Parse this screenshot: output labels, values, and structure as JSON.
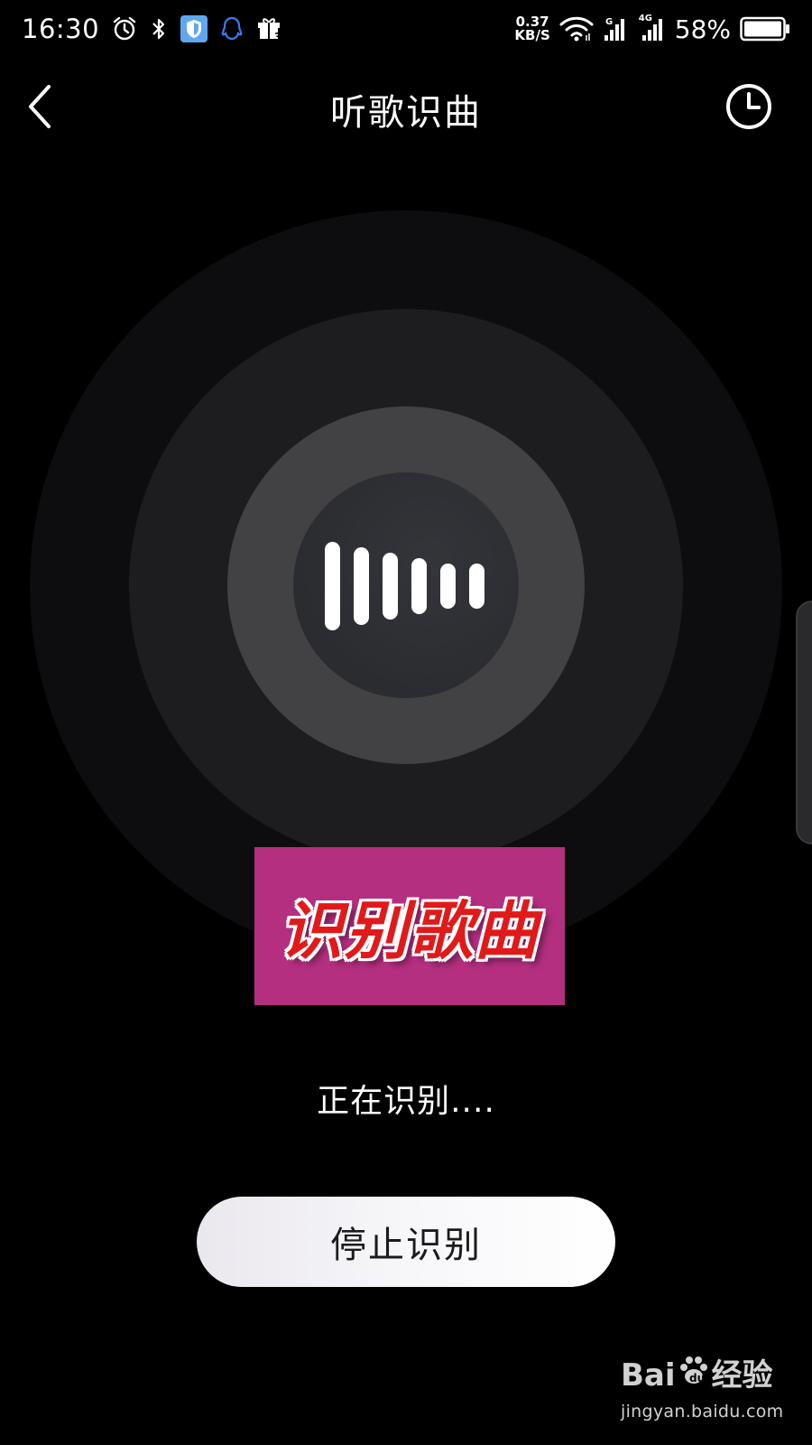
{
  "status_bar": {
    "time": "16:30",
    "net_speed_value": "0.37",
    "net_speed_unit": "KB/S",
    "network_type_label": "4G",
    "battery_percent": "58%",
    "left_icons": [
      "alarm-icon",
      "bluetooth-icon",
      "shield-app-icon",
      "qq-icon",
      "gift-icon"
    ],
    "right_icons": [
      "wifi-icon",
      "signal-icon",
      "signal-4g-icon",
      "battery-icon"
    ]
  },
  "header": {
    "title": "听歌识曲",
    "back_icon": "chevron-left-icon",
    "history_icon": "clock-icon"
  },
  "recognizer": {
    "center_icon": "sound-wave-icon",
    "caption_overlay": "识别歌曲",
    "status_text": "正在识别....",
    "stop_label": "停止识别"
  },
  "watermark": {
    "brand_left": "Bai",
    "brand_right": "经验",
    "url": "jingyan.baidu.com"
  },
  "colors": {
    "background": "#000000",
    "caption_bg": "#b42f80",
    "caption_text": "#e01a1a",
    "button_bg": "#f4f3f7"
  }
}
